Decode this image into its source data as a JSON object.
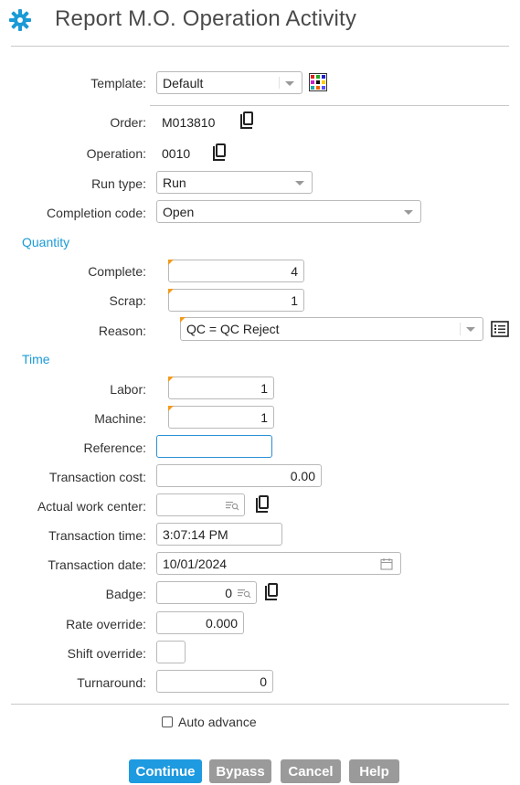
{
  "title": "Report M.O. Operation Activity",
  "colors": {
    "accent": "#1b9ad6",
    "button_primary": "#1e9ae0",
    "button_gray": "#9a9a9a",
    "required_marker": "#f39a1c",
    "gear": "#1b9ad6"
  },
  "icons": {
    "title": "gear-icon",
    "template": "template-grid-icon",
    "copy": "copy-icon",
    "lookup": "lookup-icon",
    "list": "list-icon",
    "calendar": "calendar-icon"
  },
  "template": {
    "label": "Template:",
    "value": "Default"
  },
  "order": {
    "label": "Order:",
    "value": "M013810"
  },
  "operation": {
    "label": "Operation:",
    "value": "0010"
  },
  "run_type": {
    "label": "Run type:",
    "value": "Run"
  },
  "completion_code": {
    "label": "Completion code:",
    "value": "Open"
  },
  "quantity": {
    "heading": "Quantity",
    "complete": {
      "label": "Complete:",
      "value": "4"
    },
    "scrap": {
      "label": "Scrap:",
      "value": "1"
    },
    "reason": {
      "label": "Reason:",
      "value": "QC = QC Reject"
    }
  },
  "time": {
    "heading": "Time",
    "labor": {
      "label": "Labor:",
      "value": "1"
    },
    "machine": {
      "label": "Machine:",
      "value": "1"
    }
  },
  "reference": {
    "label": "Reference:",
    "value": ""
  },
  "transaction_cost": {
    "label": "Transaction cost:",
    "value": "0.00"
  },
  "actual_work_center": {
    "label": "Actual work center:",
    "value": ""
  },
  "transaction_time": {
    "label": "Transaction time:",
    "value": "3:07:14 PM"
  },
  "transaction_date": {
    "label": "Transaction date:",
    "value": "10/01/2024"
  },
  "badge": {
    "label": "Badge:",
    "value": "0"
  },
  "rate_override": {
    "label": "Rate override:",
    "value": "0.000"
  },
  "shift_override": {
    "label": "Shift override:",
    "value": ""
  },
  "turnaround": {
    "label": "Turnaround:",
    "value": "0"
  },
  "auto_advance": {
    "label": "Auto advance",
    "checked": false
  },
  "buttons": {
    "continue": "Continue",
    "bypass": "Bypass",
    "cancel": "Cancel",
    "help": "Help"
  }
}
